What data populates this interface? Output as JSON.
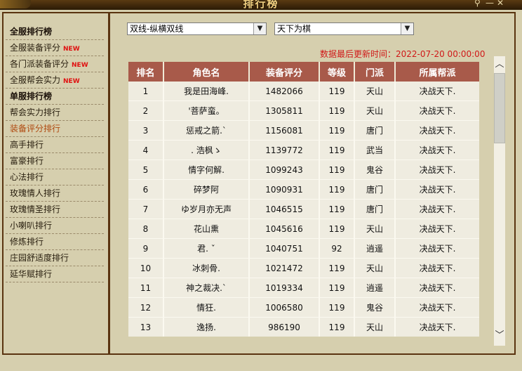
{
  "window": {
    "title": "排行榜",
    "pin_icon": "pin-icon",
    "minimize_label": "—",
    "close_label": "✕"
  },
  "sidebar": {
    "items": [
      {
        "label": "全服排行榜",
        "type": "header"
      },
      {
        "label": "全服装备评分",
        "new": "NEW"
      },
      {
        "label": "各门派装备评分",
        "new": "NEW"
      },
      {
        "label": "全服帮会实力",
        "new": "NEW"
      },
      {
        "label": "单服排行榜",
        "type": "header"
      },
      {
        "label": "帮会实力排行"
      },
      {
        "label": "装备评分排行",
        "active": true
      },
      {
        "label": "高手排行"
      },
      {
        "label": "富豪排行"
      },
      {
        "label": "心法排行"
      },
      {
        "label": "玫瑰情人排行"
      },
      {
        "label": "玫瑰情圣排行"
      },
      {
        "label": "小喇叭排行"
      },
      {
        "label": "修炼排行"
      },
      {
        "label": "庄园舒适度排行"
      },
      {
        "label": "延华赋排行"
      }
    ]
  },
  "filters": {
    "server_select": "双线-纵横双线",
    "region_select": "天下为棋",
    "arrow": "▼"
  },
  "update_time": "数据最后更新时间：2022-07-20 00:00:00",
  "table": {
    "headers": [
      "排名",
      "角色名",
      "装备评分",
      "等级",
      "门派",
      "所属帮派"
    ],
    "rows": [
      [
        "1",
        "我是田海峰.",
        "1482066",
        "119",
        "天山",
        "决战天下."
      ],
      [
        "2",
        "'菩萨蛮。",
        "1305811",
        "119",
        "天山",
        "决战天下."
      ],
      [
        "3",
        "惩戒之箭.`",
        "1156081",
        "119",
        "唐门",
        "决战天下."
      ],
      [
        "4",
        ". 浩枫ゝ",
        "1139772",
        "119",
        "武当",
        "决战天下."
      ],
      [
        "5",
        "情字何解.",
        "1099243",
        "119",
        "鬼谷",
        "决战天下."
      ],
      [
        "6",
        "碎梦阿",
        "1090931",
        "119",
        "唐门",
        "决战天下."
      ],
      [
        "7",
        "ゆ岁月亦无声",
        "1046515",
        "119",
        "唐门",
        "决战天下."
      ],
      [
        "8",
        "花山熏",
        "1045616",
        "119",
        "天山",
        "决战天下."
      ],
      [
        "9",
        "君. ˇ",
        "1040751",
        "92",
        "逍遥",
        "决战天下."
      ],
      [
        "10",
        "冰刺骨.",
        "1021472",
        "119",
        "天山",
        "决战天下."
      ],
      [
        "11",
        "神之裁决.`",
        "1019334",
        "119",
        "逍遥",
        "决战天下."
      ],
      [
        "12",
        "情狂.",
        "1006580",
        "119",
        "鬼谷",
        "决战天下."
      ],
      [
        "13",
        "逸扬.",
        "986190",
        "119",
        "天山",
        "决战天下."
      ]
    ]
  },
  "scrollbar": {
    "up": "︿",
    "down": "﹀"
  }
}
